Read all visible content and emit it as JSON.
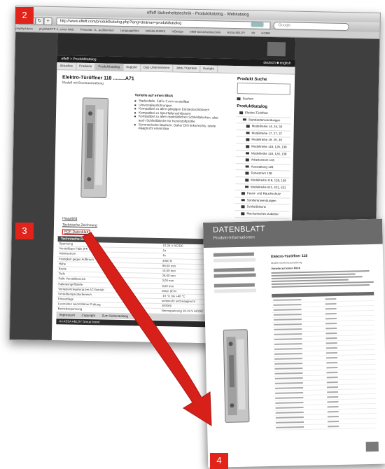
{
  "browser": {
    "window_title": "effeff Sicherheitstechnik - Produktkatalog - Webkatalog",
    "url": "http://www.effeff.com/produktkatalog.php?lang=de&nav=produktkatalog",
    "search_placeholder": "Google",
    "bookmarks": [
      "phpMyAdmin",
      "phpWebFTP 4...erver Web",
      "Personal - A...auditiontool",
      "LanguageWire",
      "WANALIZARIS",
      "InDesign",
      "effeff Sicherheitstechnik",
      "ASSA ABLOY",
      "Mr",
      "HOME"
    ]
  },
  "site": {
    "breadcrumb": "effeff > Produktkatalog",
    "language": "deutsch ■ english",
    "nav": [
      "Aktuelles",
      "Produkte",
      "Produktkatalog",
      "Support",
      "Das Unternehmen",
      "Jobs / Karriere",
      "Kontakt"
    ],
    "active_nav": "Produktkatalog",
    "product_title": "Elektro-Türöffner 118 .........A71",
    "product_subtitle": "Modell mit Bootsaussattung",
    "vorteile_heading": "Vorteile auf einen Blick",
    "features": [
      "Radiusfalle, FaFix 3 mm verstellbar",
      "Universalausführungen",
      "Kompatibel zu allen gängigen Einsteckschlössern",
      "Kompatibel zu Sperrfallenschlössern",
      "Kompatibel zu allen marktüblichen Schließblechen, also auch Schließbleche für Kunststoffprofile",
      "Symmetrische Bauform. Daher DIN links/rechts, sowie waagrecht einsetzbar"
    ],
    "links": [
      "Hauptbild",
      "Technische Zeichnung",
      "PDF-Datenblatt"
    ],
    "tech_heading": "Technische Daten",
    "tech_rows": [
      {
        "k": "Spannung",
        "v": "10-24 V AC/DC"
      },
      {
        "k": "Verstellbare Falle (FF, FaFix)",
        "v": "Ja"
      },
      {
        "k": "Arbeitsstrom",
        "v": "Ja"
      },
      {
        "k": "Festigkeit gegen Aufbruch",
        "v": "3000 N"
      },
      {
        "k": "Höhe",
        "v": "98,50 mm"
      },
      {
        "k": "Breite",
        "v": "16,00 mm"
      },
      {
        "k": "Tiefe",
        "v": "28,50 mm"
      },
      {
        "k": "Falle Verstellbereich",
        "v": "3,00 mm"
      },
      {
        "k": "Falleneingriffstiefe",
        "v": "8,50 mm"
      },
      {
        "k": "Vorlastentriegelung bei AC Betrieb",
        "v": "Mind. 80 N"
      },
      {
        "k": "Schleiftemperaturbereich",
        "v": "-15 °C bis +40 °C"
      },
      {
        "k": "Einsatzlage",
        "v": "senkrecht und waagrecht"
      },
      {
        "k": "Leerzeiten wenn/Intime Prüfung",
        "v": "200000"
      },
      {
        "k": "Betriebsspannung",
        "v": "Nennspannung 10-24 V AC/DC"
      },
      {
        "k": "Normausführung",
        "v": ""
      }
    ],
    "footer_links": [
      "Impressum",
      "Copyright",
      "Zum Seitenanfang"
    ],
    "footer_bar": "An ASSA ABLOY Group brand",
    "sidebar": {
      "search_heading": "Produkt Suche",
      "search_button": "Suchen",
      "catalog_heading": "Produktkatalog",
      "items": [
        {
          "label": "Elektro-Türöffner",
          "level": 1
        },
        {
          "label": "Standardanwendungen",
          "level": 2
        },
        {
          "label": "Modellreihe 14, 24, 34",
          "level": 3
        },
        {
          "label": "Modellreihe 17, 27, 37",
          "level": 3
        },
        {
          "label": "Modellreihe 19, 29, 39",
          "level": 3
        },
        {
          "label": "Modellreihe 118, 128, 138",
          "level": 3
        },
        {
          "label": "Modellreihe 118, 128, 138",
          "level": 3
        },
        {
          "label": "Arbeitsstrom 118",
          "level": 3
        },
        {
          "label": "Ausstattung 128",
          "level": 3
        },
        {
          "label": "Ruhestrom 138",
          "level": 3
        },
        {
          "label": "Modellreihe 118, 128, 138",
          "level": 3
        },
        {
          "label": "Modellreihe 611, 621, 631",
          "level": 3
        },
        {
          "label": "Feuer- und Rauchschutz",
          "level": 2
        },
        {
          "label": "Sonderanwendungen",
          "level": 2
        },
        {
          "label": "Schließbleche",
          "level": 2
        },
        {
          "label": "Mechanisches Zubehör",
          "level": 2
        }
      ]
    }
  },
  "datasheet": {
    "title": "DATENBLATT",
    "subtitle": "Produkt-Informationen",
    "product_title": "Elektro-Türöffner 118",
    "product_subtitle": "Modell mit Bootsaussattung",
    "vorteile_heading": "Vorteile auf einen Blick"
  },
  "badges": [
    "2",
    "3",
    "4"
  ],
  "colors": {
    "badge_red": "#e2231a",
    "arrow_red": "#d8201a",
    "header_dark": "#2b2b2b"
  }
}
